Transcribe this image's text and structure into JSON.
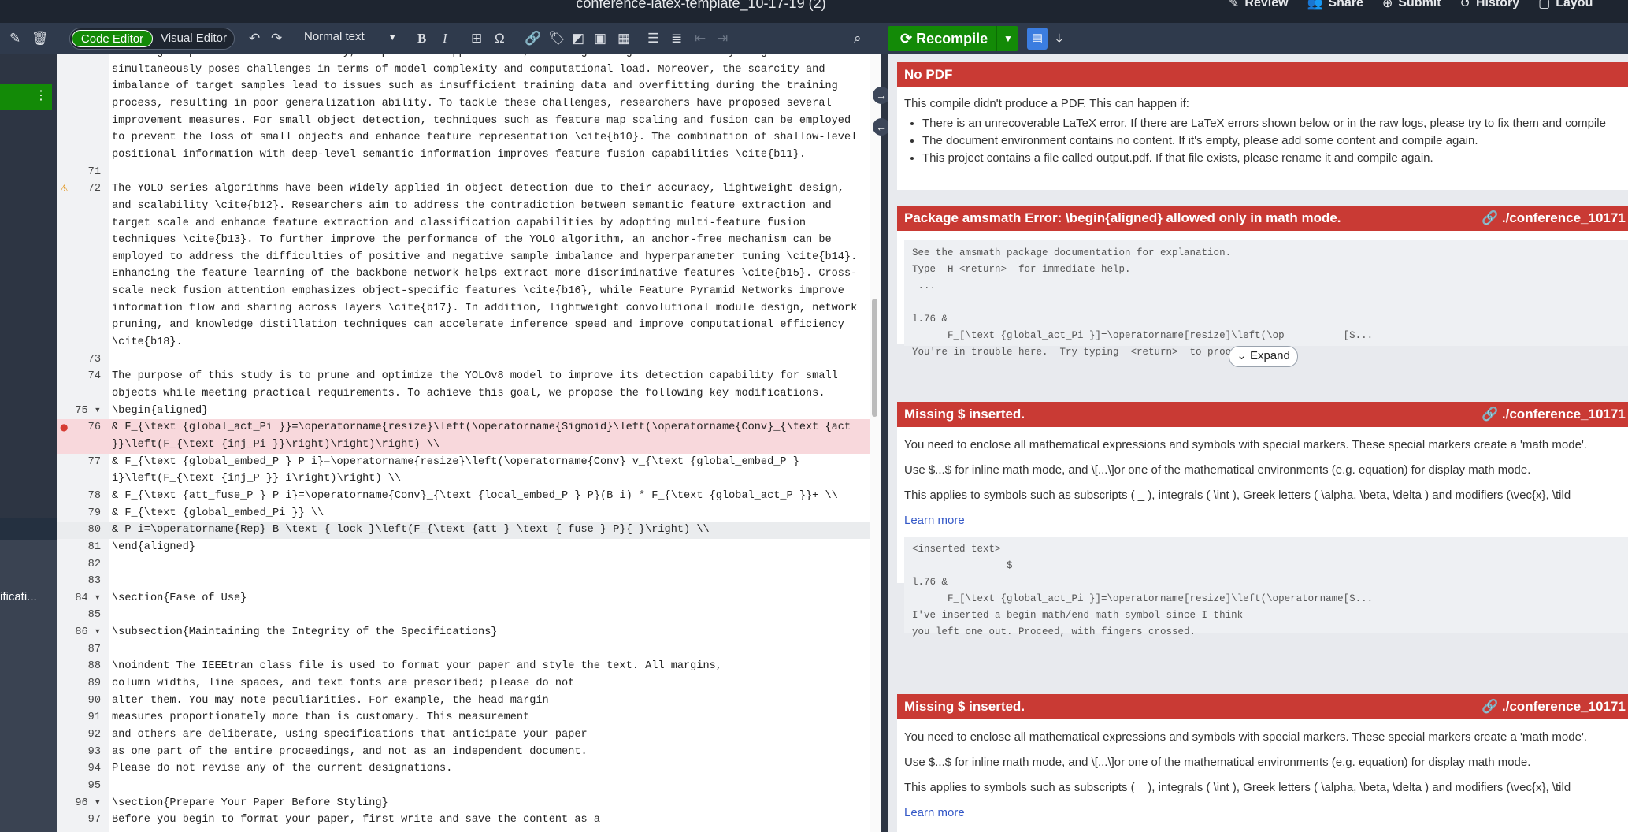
{
  "header": {
    "title": "conference-latex-template_10-17-19 (2)",
    "actions": [
      {
        "icon": "review-icon",
        "label": "Review"
      },
      {
        "icon": "share-icon",
        "label": "Share"
      },
      {
        "icon": "submit-icon",
        "label": "Submit"
      },
      {
        "icon": "history-icon",
        "label": "History"
      },
      {
        "icon": "layout-icon",
        "label": "Layou"
      }
    ]
  },
  "editor_toolbar": {
    "code_editor": "Code Editor",
    "visual_editor": "Visual Editor",
    "normal_text": "Normal text",
    "bold": "B",
    "italic": "I",
    "omega": "Ω"
  },
  "preview_toolbar": {
    "recompile": "Recompile"
  },
  "sidebar": {
    "spec_label": "ificati..."
  },
  "editor": {
    "lines": [
      {
        "num": "",
        "text": "and large aspect ratios. Additionally, in practical applications, handling a large batch of X-ray images"
      },
      {
        "num": "",
        "text": "simultaneously poses challenges in terms of model complexity and computational load. Moreover, the scarcity and"
      },
      {
        "num": "",
        "text": "imbalance of target samples lead to issues such as insufficient training data and overfitting during the training"
      },
      {
        "num": "",
        "text": "process, resulting in poor generalization ability. To tackle these challenges, researchers have proposed several"
      },
      {
        "num": "",
        "text": "improvement measures. For small object detection, techniques such as feature map scaling and fusion can be employed"
      },
      {
        "num": "",
        "text": "to prevent the loss of small objects and enhance feature representation \\cite{b10}. The combination of shallow-level"
      },
      {
        "num": "",
        "text": "positional information with deep-level semantic information improves feature fusion capabilities \\cite{b11}."
      },
      {
        "num": "71",
        "text": ""
      },
      {
        "num": "72",
        "text": "The YOLO series algorithms have been widely applied in object detection due to their accuracy, lightweight design,"
      },
      {
        "num": "",
        "text": "and scalability \\cite{b12}. Researchers aim to address the contradiction between semantic feature extraction and"
      },
      {
        "num": "",
        "text": "target scale and enhance feature extraction and classification capabilities by adopting multi-feature fusion"
      },
      {
        "num": "",
        "text": "techniques \\cite{b13}. To further improve the performance of the YOLO algorithm, an anchor-free mechanism can be"
      },
      {
        "num": "",
        "text": "employed to address the difficulties of positive and negative sample imbalance and hyperparameter tuning \\cite{b14}."
      },
      {
        "num": "",
        "text": "Enhancing the feature learning of the backbone network helps extract more discriminative features \\cite{b15}. Cross-"
      },
      {
        "num": "",
        "text": "scale neck fusion attention emphasizes object-specific features \\cite{b16}, while Feature Pyramid Networks improve"
      },
      {
        "num": "",
        "text": "information flow and sharing across layers \\cite{b17}. In addition, lightweight convolutional module design, network"
      },
      {
        "num": "",
        "text": "pruning, and knowledge distillation techniques can accelerate inference speed and improve computational efficiency"
      },
      {
        "num": "",
        "text": "\\cite{b18}."
      },
      {
        "num": "73",
        "text": ""
      },
      {
        "num": "74",
        "text": "The purpose of this study is to prune and optimize the YOLOv8 model to improve its detection capability for small"
      },
      {
        "num": "",
        "text": "objects while meeting practical requirements. To achieve this goal, we propose the following key modifications."
      },
      {
        "num": "75 ▾",
        "text": "\\begin{aligned}"
      },
      {
        "num": "76",
        "text": "& F_{\\text {global_act_Pi }}=\\operatorname{resize}\\left(\\operatorname{Sigmoid}\\left(\\operatorname{Conv}_{\\text {act"
      },
      {
        "num": "",
        "text": "}}\\left(F_{\\text {inj_Pi }}\\right)\\right)\\right) \\\\"
      },
      {
        "num": "77",
        "text": "& F_{\\text {global_embed_P } P i}=\\operatorname{resize}\\left(\\operatorname{Conv} v_{\\text {global_embed_P }"
      },
      {
        "num": "",
        "text": "i}\\left(F_{\\text {inj_P }} i\\right)\\right) \\\\"
      },
      {
        "num": "78",
        "text": "& F_{\\text {att_fuse_P } P i}=\\operatorname{Conv}_{\\text {local_embed_P } P}(B i) * F_{\\text {global_act_P }}+ \\\\"
      },
      {
        "num": "79",
        "text": "& F_{\\text {global_embed_Pi }} \\\\"
      },
      {
        "num": "80",
        "text": "& P i=\\operatorname{Rep} B \\text { lock }\\left(F_{\\text {att } \\text { fuse } P}{ }\\right) \\\\"
      },
      {
        "num": "81",
        "text": "\\end{aligned}"
      },
      {
        "num": "82",
        "text": ""
      },
      {
        "num": "83",
        "text": ""
      },
      {
        "num": "84 ▾",
        "text": "\\section{Ease of Use}"
      },
      {
        "num": "85",
        "text": ""
      },
      {
        "num": "86 ▾",
        "text": "\\subsection{Maintaining the Integrity of the Specifications}"
      },
      {
        "num": "87",
        "text": ""
      },
      {
        "num": "88",
        "text": "\\noindent The IEEEtran class file is used to format your paper and style the text. All margins,"
      },
      {
        "num": "89",
        "text": "column widths, line spaces, and text fonts are prescribed; please do not"
      },
      {
        "num": "90",
        "text": "alter them. You may note peculiarities. For example, the head margin"
      },
      {
        "num": "91",
        "text": "measures proportionately more than is customary. This measurement"
      },
      {
        "num": "92",
        "text": "and others are deliberate, using specifications that anticipate your paper"
      },
      {
        "num": "93",
        "text": "as one part of the entire proceedings, and not as an independent document."
      },
      {
        "num": "94",
        "text": "Please do not revise any of the current designations."
      },
      {
        "num": "95",
        "text": ""
      },
      {
        "num": "96 ▾",
        "text": "\\section{Prepare Your Paper Before Styling}"
      },
      {
        "num": "97",
        "text": "Before you begin to format your paper, first write and save the content as a"
      }
    ]
  },
  "preview": {
    "no_pdf": {
      "title": "No PDF",
      "intro": "This compile didn't produce a PDF. This can happen if:",
      "bullets": [
        "There is an unrecoverable LaTeX error. If there are LaTeX errors shown below or in the raw logs, please try to fix them and compile",
        "The document environment contains no content. If it's empty, please add some content and compile again.",
        "This project contains a file called output.pdf. If that file exists, please rename it and compile again."
      ]
    },
    "error1": {
      "title": "Package amsmath Error: \\begin{aligned} allowed only in math mode.",
      "file": "./conference_10171",
      "code": "See the amsmath package documentation for explanation.\nType  H <return>  for immediate help.\n ...\n\nl.76 &\n      F_[\\text {global_act_Pi }]=\\operatorname[resize]\\left(\\op          [S...\nYou're in trouble here.  Try typing  <return>  to proceed.",
      "expand": "Expand"
    },
    "error2": {
      "title": "Missing $ inserted.",
      "file": "./conference_10171",
      "line1": "You need to enclose all mathematical expressions and symbols with special markers. These special markers create a 'math mode'.",
      "line2": "Use $...$ for inline math mode, and \\[...\\]or one of the mathematical environments (e.g. equation) for display math mode.",
      "line3": "This applies to symbols such as subscripts ( _ ), integrals ( \\int ), Greek letters ( \\alpha, \\beta, \\delta ) and modifiers (\\vec{x}, \\tild",
      "learn_more": "Learn more",
      "code": "<inserted text>\n                $\nl.76 &\n      F_[\\text {global_act_Pi }]=\\operatorname[resize]\\left(\\operatorname[S...\nI've inserted a begin-math/end-math symbol since I think\nyou left one out. Proceed, with fingers crossed."
    },
    "error3": {
      "title": "Missing $ inserted.",
      "file": "./conference_10171",
      "line1": "You need to enclose all mathematical expressions and symbols with special markers. These special markers create a 'math mode'.",
      "line2": "Use $...$ for inline math mode, and \\[...\\]or one of the mathematical environments (e.g. equation) for display math mode.",
      "line3": "This applies to symbols such as subscripts ( _ ), integrals ( \\int ), Greek letters ( \\alpha, \\beta, \\delta ) and modifiers (\\vec{x}, \\tild",
      "learn_more": "Learn more"
    }
  }
}
